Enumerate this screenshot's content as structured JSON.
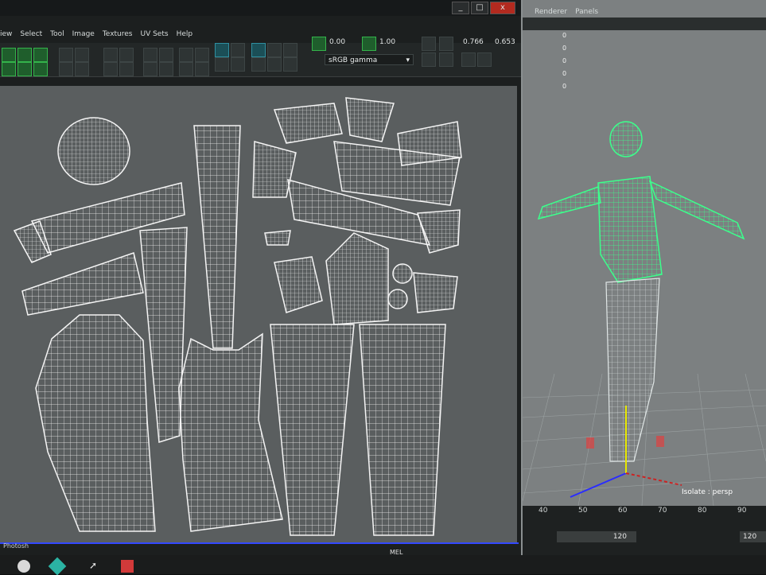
{
  "uv_editor": {
    "menu": [
      "iew",
      "Select",
      "Tool",
      "Image",
      "Textures",
      "UV Sets",
      "Help"
    ],
    "fields": {
      "value_a": "0.00",
      "value_b": "1.00",
      "value_c": "0.766",
      "value_d": "0.653"
    },
    "color_space": "sRGB gamma",
    "window_buttons": [
      "_",
      "□",
      "x"
    ],
    "colors": {
      "background": "#5a5e5f",
      "wire": "#f4f4f4",
      "accent_green": "#34b34b"
    }
  },
  "viewport": {
    "menu": [
      "Renderer",
      "Panels"
    ],
    "hud_values": [
      "0",
      "0",
      "0",
      "0",
      "0"
    ],
    "camera_label": "Isolate : persp",
    "colors": {
      "wire": "#3cff8c",
      "background": "#7c8081"
    }
  },
  "timeline": {
    "ticks": [
      "40",
      "50",
      "60",
      "70",
      "80",
      "90"
    ],
    "range_end": "120",
    "range_end_2": "120"
  },
  "taskbar": {
    "mel_label": "MEL",
    "photoshop_label": "Photosh"
  }
}
